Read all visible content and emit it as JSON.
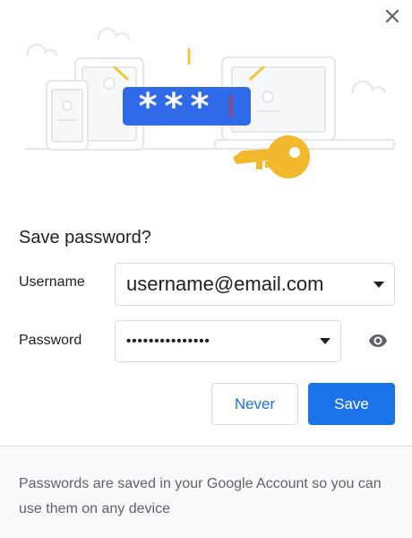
{
  "dialog": {
    "title": "Save password?",
    "close_icon": "close-icon"
  },
  "illustration": {
    "password_mask": "***",
    "colors": {
      "badge": "#2f6ae8",
      "key": "#f2b92e",
      "spark": "#f4c63d",
      "cursor": "#d93025",
      "outline": "#e3e6ea"
    }
  },
  "fields": {
    "username": {
      "label": "Username",
      "value": "username@email.com"
    },
    "password": {
      "label": "Password",
      "value": "•••••••••••••••",
      "reveal_icon": "eye-icon"
    }
  },
  "buttons": {
    "never": "Never",
    "save": "Save"
  },
  "footer": {
    "text": "Passwords are saved in your Google Account so you can use them on any device"
  },
  "colors": {
    "accent": "#1a73e8",
    "footer_bg": "#f8f9fa"
  }
}
